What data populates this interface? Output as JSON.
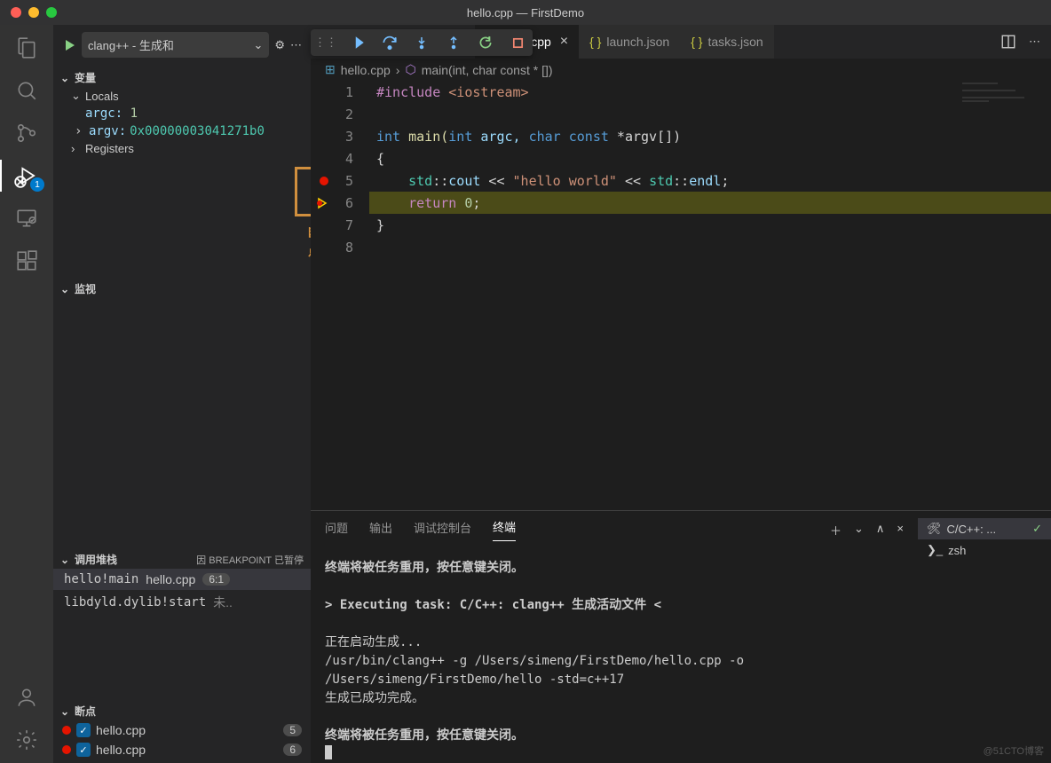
{
  "titlebar": {
    "title": "hello.cpp — FirstDemo"
  },
  "activity": {
    "debug_badge": "1"
  },
  "debug_config": {
    "label": "clang++ - 生成和"
  },
  "sidebar": {
    "variables": {
      "title": "变量",
      "locals": "Locals",
      "argc_name": "argc:",
      "argc_val": "1",
      "argv_name": "argv:",
      "argv_val": "0x00000003041271b0",
      "registers": "Registers"
    },
    "watch": {
      "title": "监视"
    },
    "callstack": {
      "title": "调用堆栈",
      "status": "因 BREAKPOINT 已暂停",
      "f0_fn": "hello!main",
      "f0_file": "hello.cpp",
      "f0_pos": "6:1",
      "f1_fn": "libdyld.dylib!start",
      "f1_status": "未.."
    },
    "breakpoints": {
      "title": "断点",
      "b0_file": "hello.cpp",
      "b0_line": "5",
      "b1_file": "hello.cpp",
      "b1_line": "6"
    },
    "annotation": "断点"
  },
  "tabs": {
    "t0": "hello.cpp",
    "t1": "launch.json",
    "t2": "tasks.json"
  },
  "breadcrumb": {
    "file": "hello.cpp",
    "symbol": "main(int, char const * [])"
  },
  "gutter": {
    "l1": "1",
    "l2": "2",
    "l3": "3",
    "l4": "4",
    "l5": "5",
    "l6": "6",
    "l7": "7",
    "l8": "8"
  },
  "code": {
    "l1_a": "#include",
    "l1_b": " <iostream>",
    "l3_a": "int",
    "l3_b": " main(",
    "l3_c": "int",
    "l3_d": " argc, ",
    "l3_e": "char",
    "l3_f": " ",
    "l3_g": "const",
    "l3_h": " *argv[])",
    "l4": "{",
    "l5_a": "    std",
    "l5_b": "::",
    "l5_c": "cout",
    "l5_d": " << ",
    "l5_e": "\"hello world\"",
    "l5_f": " << ",
    "l5_g": "std",
    "l5_h": "::",
    "l5_i": "endl",
    "l5_j": ";",
    "l6_a": "    ",
    "l6_b": "return",
    "l6_c": " ",
    "l6_d": "0",
    "l6_e": ";",
    "l7": "}"
  },
  "panel": {
    "tabs": {
      "problems": "问题",
      "output": "输出",
      "debug_console": "调试控制台",
      "terminal": "终端"
    },
    "terminal": {
      "line1": "终端将被任务重用，按任意键关闭。",
      "line2": "> Executing task: C/C++: clang++ 生成活动文件 <",
      "line3": "正在启动生成...",
      "line4": "/usr/bin/clang++ -g /Users/simeng/FirstDemo/hello.cpp -o /Users/simeng/FirstDemo/hello -std=c++17",
      "line5": "生成已成功完成。",
      "line6": "终端将被任务重用，按任意键关闭。"
    },
    "term_side": {
      "t0": "C/C++: ...",
      "t1": "zsh"
    }
  },
  "watermark": "@51CTO博客"
}
